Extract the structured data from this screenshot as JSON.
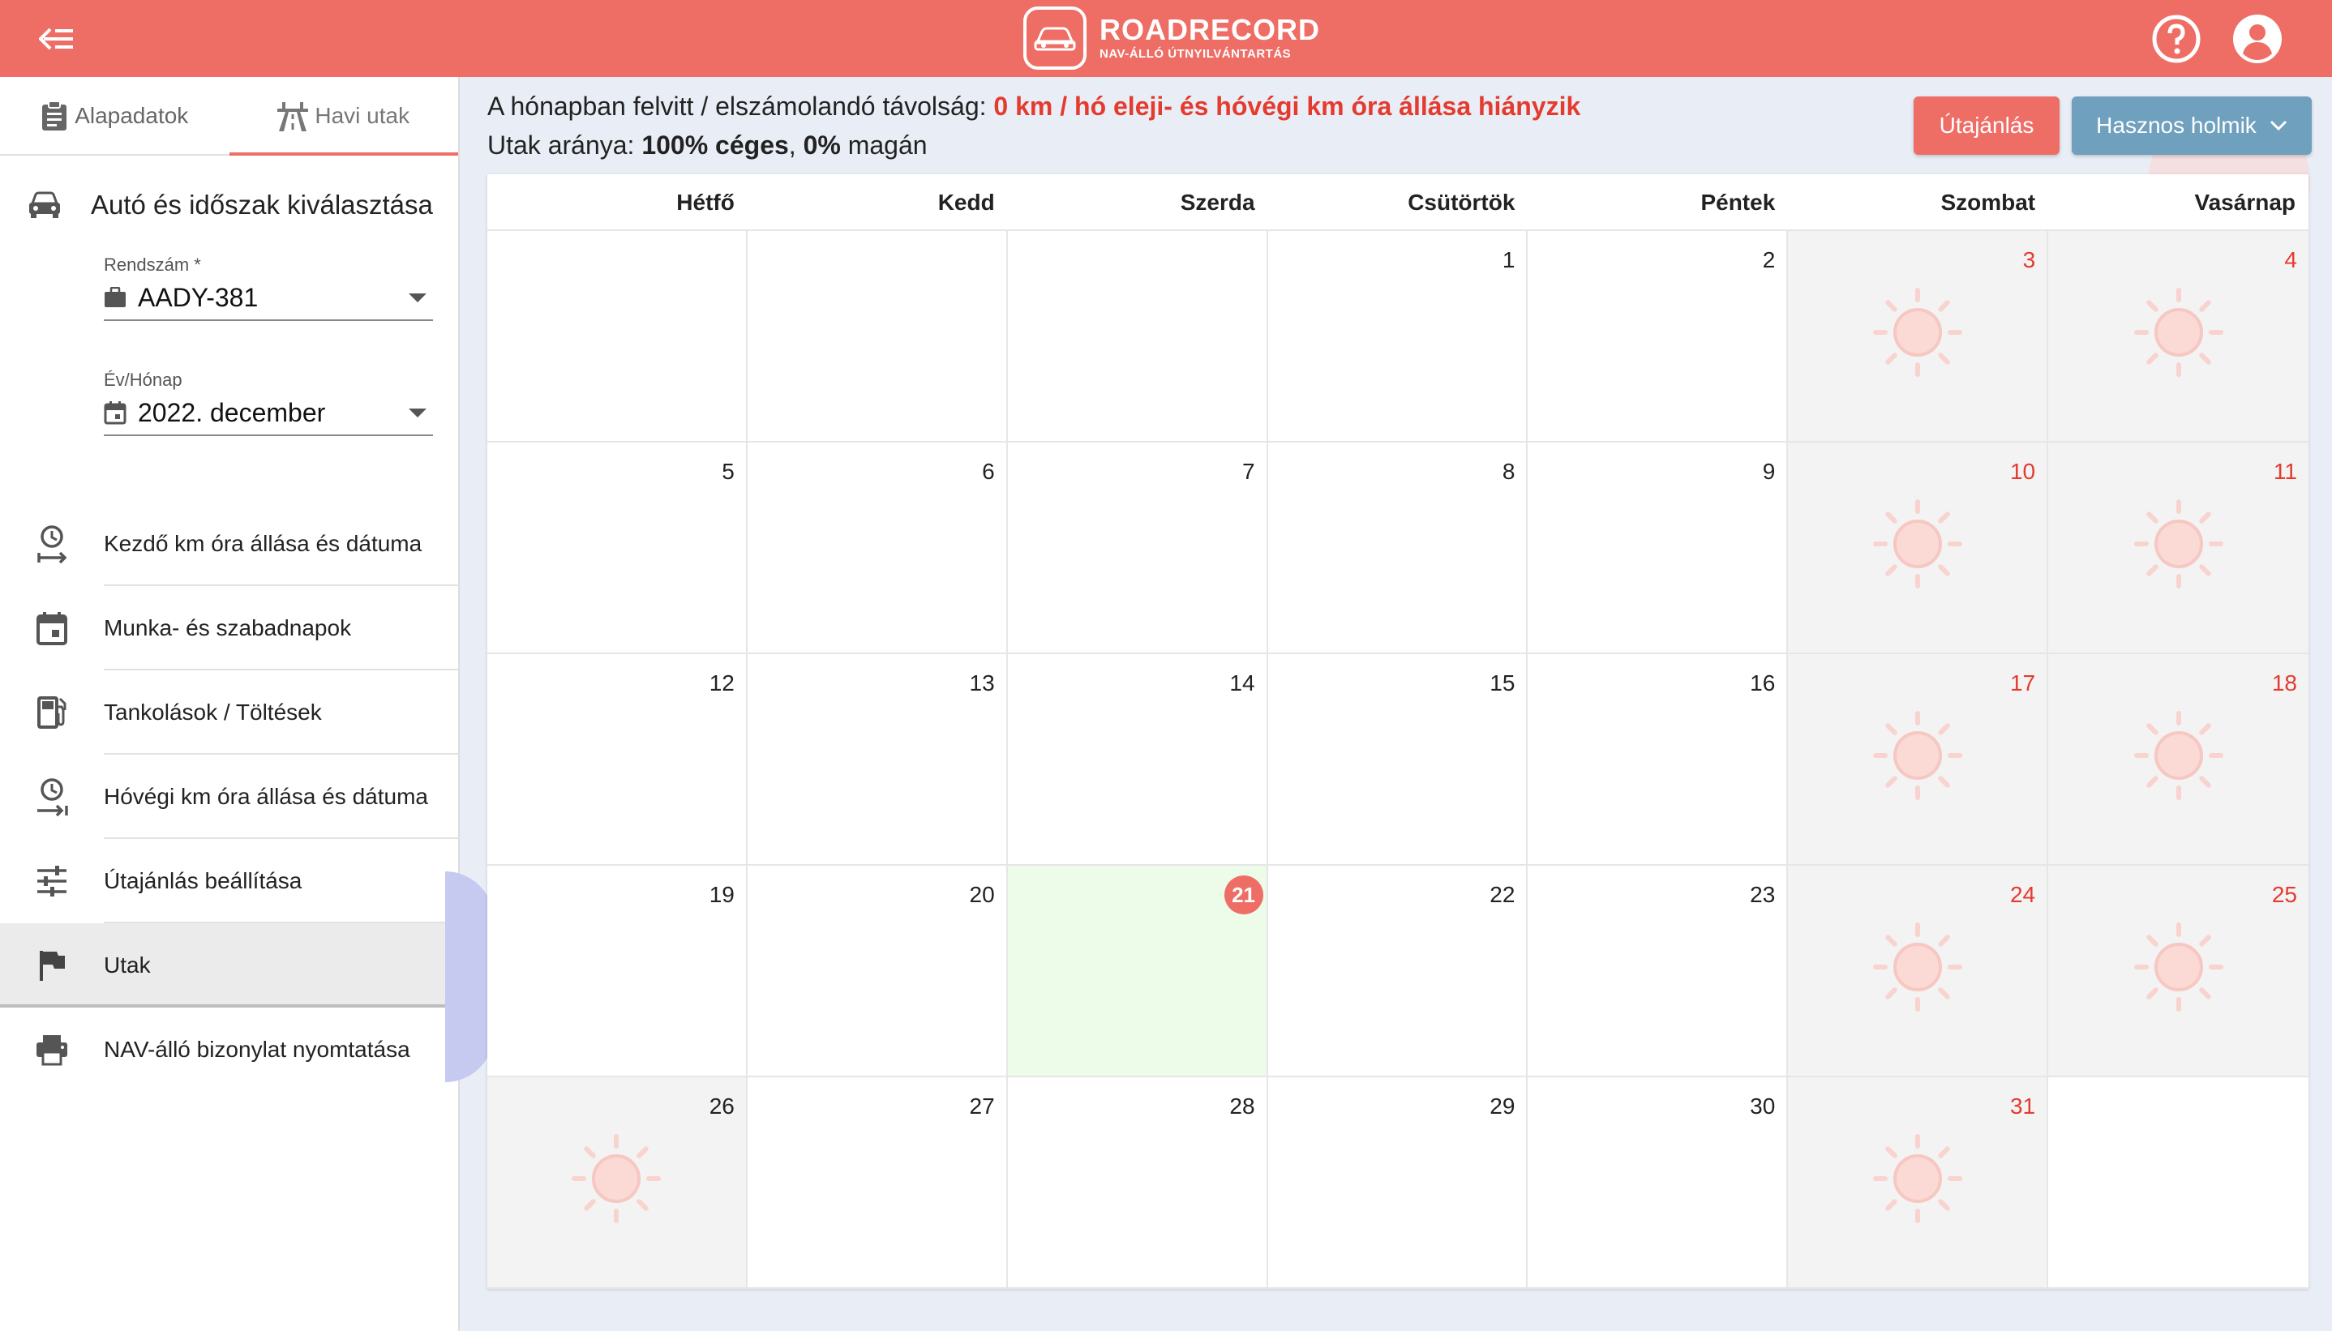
{
  "brand": {
    "name": "ROADRECORD",
    "sub": "NAV-ÁLLÓ ÚTNYILVÁNTARTÁS"
  },
  "colors": {
    "accent": "#ee6e66",
    "secondary": "#6fa0bd",
    "warn": "#e53a2e",
    "today_bg": "#edfbe9"
  },
  "sidebar": {
    "tabs": [
      {
        "label": "Alapadatok"
      },
      {
        "label": "Havi utak"
      }
    ],
    "section_title": "Autó és időszak kiválasztása",
    "plate": {
      "label": "Rendszám *",
      "value": "AADY-381"
    },
    "month": {
      "label": "Év/Hónap",
      "value": "2022. december"
    },
    "items": [
      {
        "label": "Kezdő km óra állása és dátuma",
        "icon": "clock-start-icon"
      },
      {
        "label": "Munka- és szabadnapok",
        "icon": "calendar-icon"
      },
      {
        "label": "Tankolások / Töltések",
        "icon": "fuel-icon"
      },
      {
        "label": "Hóvégi km óra állása és dátuma",
        "icon": "clock-end-icon"
      },
      {
        "label": "Útajánlás beállítása",
        "icon": "tune-icon"
      },
      {
        "label": "Utak",
        "icon": "flag-icon"
      },
      {
        "label": "NAV-álló bizonylat nyomtatása",
        "icon": "printer-icon"
      }
    ]
  },
  "info": {
    "line1_prefix": "A hónapban felvitt / elszámolandó távolság: ",
    "line1_warn": "0 km / hó eleji- és hóvégi km óra állása hiányzik",
    "line2_prefix": "Utak aránya: ",
    "line2_company": "100% céges",
    "line2_sep": ", ",
    "line2_private": "0%",
    "line2_suffix": " magán"
  },
  "buttons": {
    "offer": "Útajánlás",
    "useful": "Hasznos holmik"
  },
  "calendar": {
    "weekdays": [
      "Hétfő",
      "Kedd",
      "Szerda",
      "Csütörtök",
      "Péntek",
      "Szombat",
      "Vasárnap"
    ],
    "weeks": [
      [
        "",
        "",
        "",
        "1",
        "2",
        "3",
        "4"
      ],
      [
        "5",
        "6",
        "7",
        "8",
        "9",
        "10",
        "11"
      ],
      [
        "12",
        "13",
        "14",
        "15",
        "16",
        "17",
        "18"
      ],
      [
        "19",
        "20",
        "21",
        "22",
        "23",
        "24",
        "25"
      ],
      [
        "26",
        "27",
        "28",
        "29",
        "30",
        "31",
        ""
      ]
    ],
    "today": "21"
  }
}
